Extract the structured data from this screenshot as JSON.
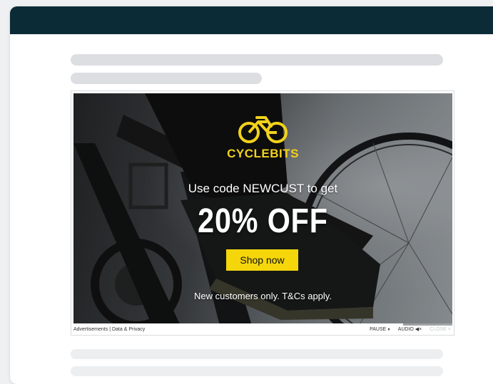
{
  "ad": {
    "brand": "CYCLEBITS",
    "promo_line": "Use code NEWCUST to get",
    "discount": "20% OFF",
    "cta_label": "Shop now",
    "terms": "New customers only. T&Cs apply.",
    "video_progress": 0.87
  },
  "ad_footer": {
    "advertisements_link": "Advertisements",
    "separator": " | ",
    "privacy_link": "Data & Privacy",
    "pause_label": "PAUSE ⏸",
    "audio_label": "AUDIO ◀×",
    "close_label": "CLOSE ×"
  },
  "colors": {
    "header": "#0b2b36",
    "brand_yellow": "#f2d21a",
    "cta_yellow": "#f5d60a",
    "skeleton": "#dcdee1"
  }
}
